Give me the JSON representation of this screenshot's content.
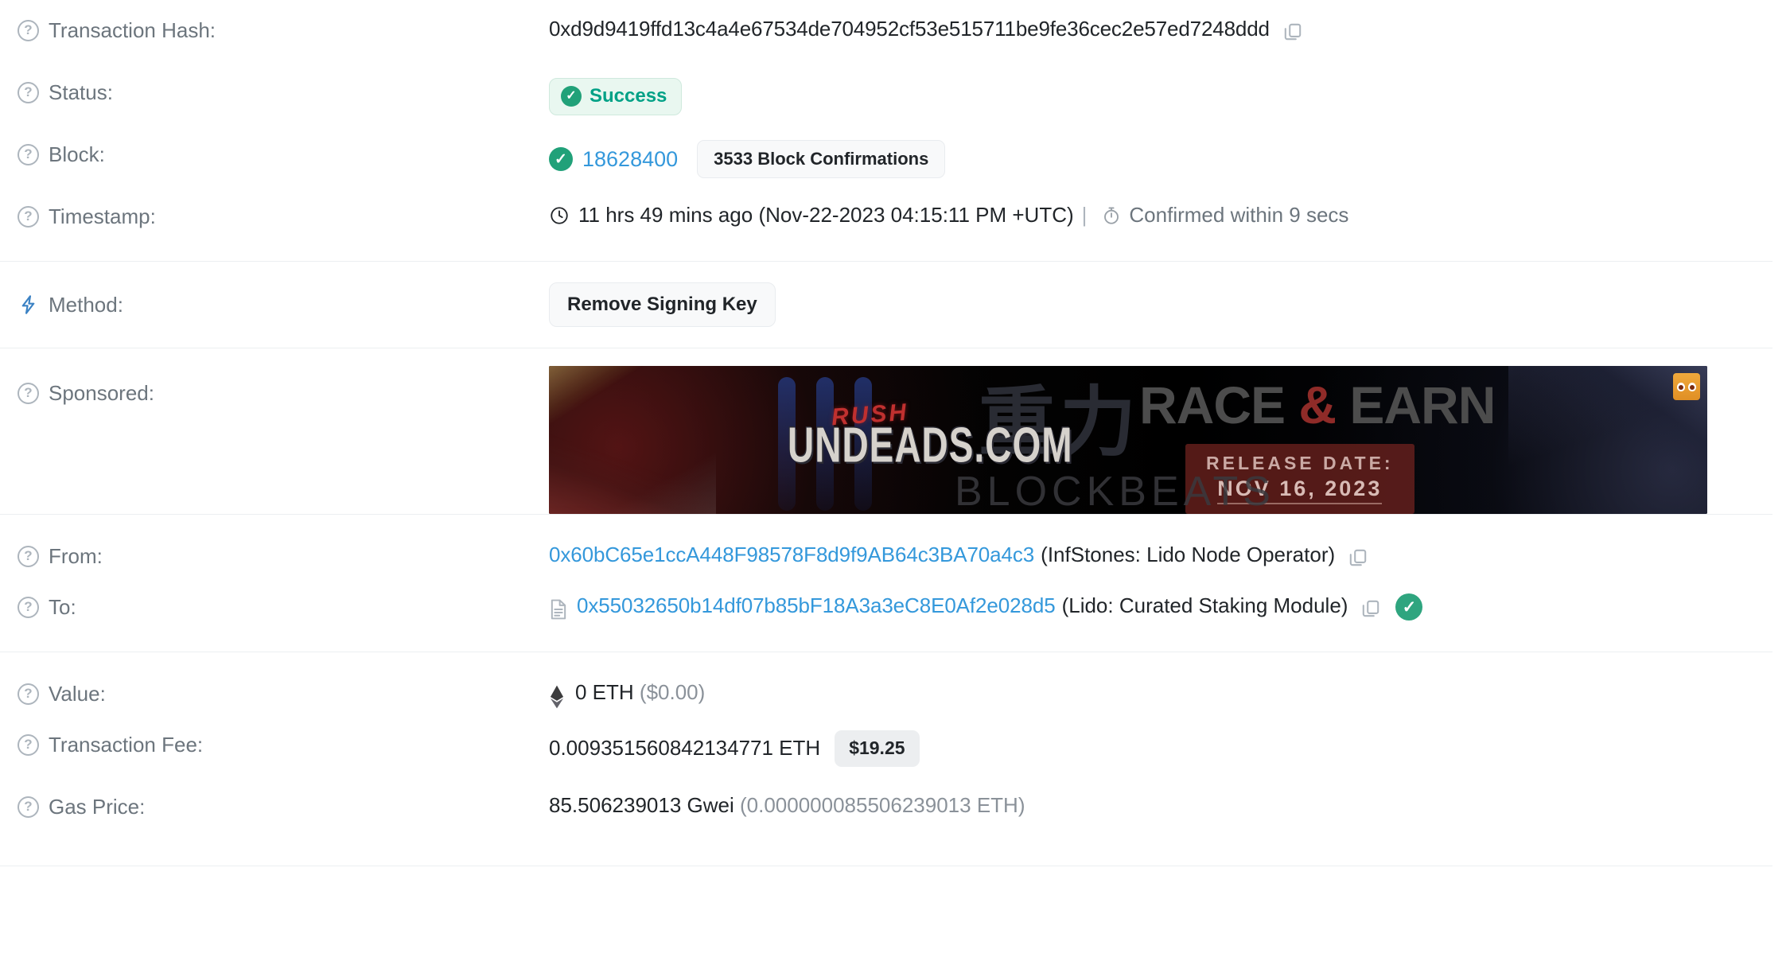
{
  "rows": {
    "transaction_hash": {
      "label": "Transaction Hash:",
      "value": "0xd9d9419ffd13c4a4e67534de704952cf53e515711be9fe36cec2e57ed7248ddd",
      "copy_icon": "copy-icon",
      "help_icon": "question-mark-icon"
    },
    "status": {
      "label": "Status:",
      "value": "Success",
      "badge_color": "#00a186",
      "badge_bg": "#e9f7f0",
      "check_icon": "check-circle-icon"
    },
    "block": {
      "label": "Block:",
      "number": "18628400",
      "confirmations": "3533 Block Confirmations",
      "link_color": "#3498db",
      "check_icon": "check-circle-icon"
    },
    "timestamp": {
      "label": "Timestamp:",
      "relative": "11 hrs 49 mins ago",
      "absolute": "(Nov-22-2023 04:15:11 PM +UTC)",
      "separator": "|",
      "confirmed_within": "Confirmed within 9 secs",
      "clock_icon": "clock-icon",
      "stopwatch_icon": "stopwatch-icon"
    },
    "method": {
      "label": "Method:",
      "value": "Remove Signing Key",
      "bolt_icon": "lightning-bolt-icon",
      "bolt_color": "#3b82c4"
    },
    "sponsored": {
      "label": "Sponsored:",
      "banner": {
        "brand_rush": "RUSH",
        "brand_domain": "UNDEADS.COM",
        "headline_1": "RACE",
        "headline_amp": "&",
        "headline_2": "EARN",
        "release_label": "RELEASE DATE:",
        "release_date": "NOV 16, 2023",
        "watermark": "BLOCKBEATS",
        "cjk_watermark": "重力",
        "ad_badge_icon": "ad-eyes-icon"
      }
    },
    "from": {
      "label": "From:",
      "address": "0x60bC65e1ccA448F98578F8d9f9AB64c3BA70a4c3",
      "tag": "(InfStones: Lido Node Operator)",
      "copy_icon": "copy-icon"
    },
    "to": {
      "label": "To:",
      "address": "0x55032650b14df07b85bF18A3a3eC8E0Af2e028d5",
      "tag": "(Lido: Curated Staking Module)",
      "contract_icon": "contract-document-icon",
      "copy_icon": "copy-icon",
      "verified_icon": "verified-check-icon",
      "verified_color": "#2fa57f"
    },
    "value": {
      "label": "Value:",
      "amount": "0 ETH",
      "fiat": "($0.00)",
      "eth_icon": "ethereum-diamond-icon"
    },
    "transaction_fee": {
      "label": "Transaction Fee:",
      "amount": "0.009351560842134771 ETH",
      "fiat_badge": "$19.25"
    },
    "gas_price": {
      "label": "Gas Price:",
      "gwei": "85.506239013 Gwei",
      "eth": "(0.000000085506239013 ETH)"
    }
  }
}
